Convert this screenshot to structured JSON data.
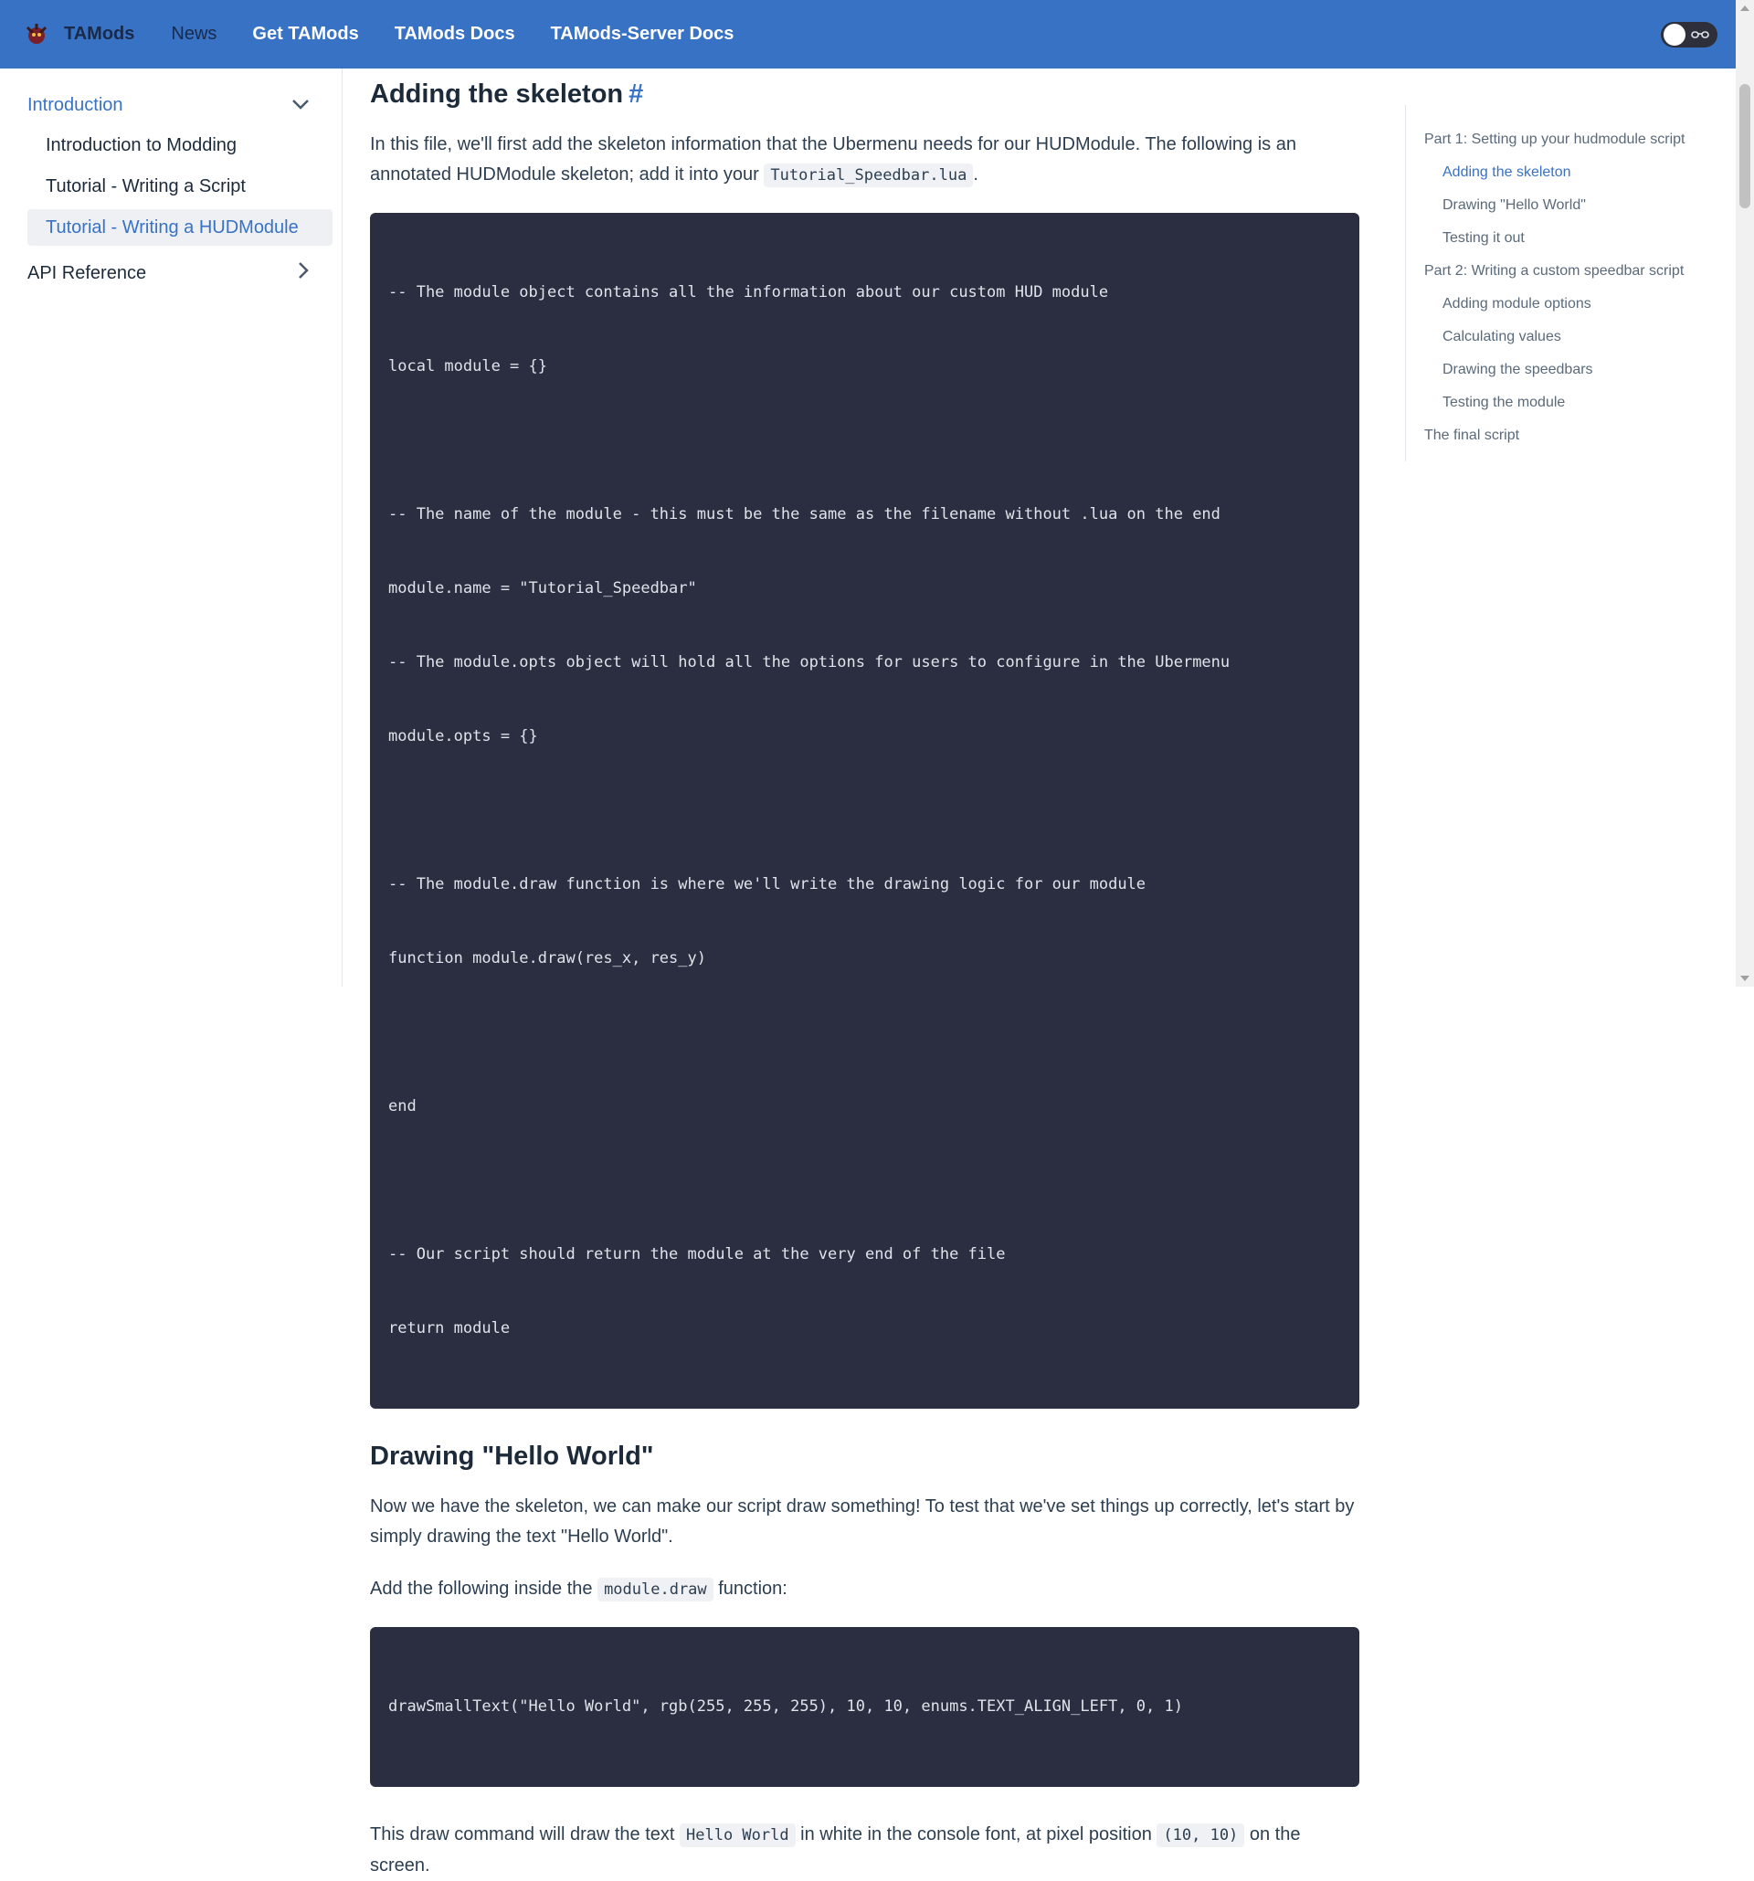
{
  "header": {
    "brand": "TAMods",
    "nav": [
      "News",
      "Get TAMods",
      "TAMods Docs",
      "TAMods-Server Docs"
    ]
  },
  "sidebar": {
    "categories": [
      {
        "label": "Introduction",
        "expanded": true,
        "items": [
          "Introduction to Modding",
          "Tutorial - Writing a Script",
          "Tutorial - Writing a HUDModule"
        ],
        "selected": "Tutorial - Writing a HUDModule"
      },
      {
        "label": "API Reference",
        "expanded": false,
        "items": []
      }
    ]
  },
  "main": {
    "section1": {
      "heading": "Adding the skeleton",
      "hash": "#",
      "para_a": "In this file, we'll first add the skeleton information that the Ubermenu needs for our HUDModule. The following is an annotated HUDModule skeleton; add it into your ",
      "para_code": "Tutorial_Speedbar.lua",
      "para_b": ".",
      "code": [
        "-- The module object contains all the information about our custom HUD module",
        "local module = {}",
        "",
        "-- The name of the module - this must be the same as the filename without .lua on the end",
        "module.name = \"Tutorial_Speedbar\"",
        "-- The module.opts object will hold all the options for users to configure in the Ubermenu",
        "module.opts = {}",
        "",
        "-- The module.draw function is where we'll write the drawing logic for our module",
        "function module.draw(res_x, res_y)",
        "",
        "end",
        "",
        "-- Our script should return the module at the very end of the file",
        "return module"
      ]
    },
    "section2": {
      "heading": "Drawing \"Hello World\"",
      "para1": "Now we have the skeleton, we can make our script draw something! To test that we've set things up correctly, let's start by simply drawing the text \"Hello World\".",
      "para2_a": "Add the following inside the ",
      "para2_code": "module.draw",
      "para2_b": " function:",
      "code": "drawSmallText(\"Hello World\", rgb(255, 255, 255), 10, 10, enums.TEXT_ALIGN_LEFT, 0, 1)",
      "para3_a": "This draw command will draw the text ",
      "para3_code1": "Hello World",
      "para3_b": " in white in the console font, at pixel position ",
      "para3_code2": "(10, 10)",
      "para3_c": " on the screen."
    }
  },
  "toc": {
    "items": [
      {
        "label": "Part 1: Setting up your hudmodule script",
        "level": 1
      },
      {
        "label": "Adding the skeleton",
        "level": 2,
        "current": true
      },
      {
        "label": "Drawing \"Hello World\"",
        "level": 2
      },
      {
        "label": "Testing it out",
        "level": 2
      },
      {
        "label": "Part 2: Writing a custom speedbar script",
        "level": 1
      },
      {
        "label": "Adding module options",
        "level": 2
      },
      {
        "label": "Calculating values",
        "level": 2
      },
      {
        "label": "Drawing the speedbars",
        "level": 2
      },
      {
        "label": "Testing the module",
        "level": 2
      },
      {
        "label": "The final script",
        "level": 1
      }
    ]
  },
  "colors": {
    "navbar": "#3872c4",
    "accent": "#3872c4",
    "code_bg": "#2b2e40"
  }
}
